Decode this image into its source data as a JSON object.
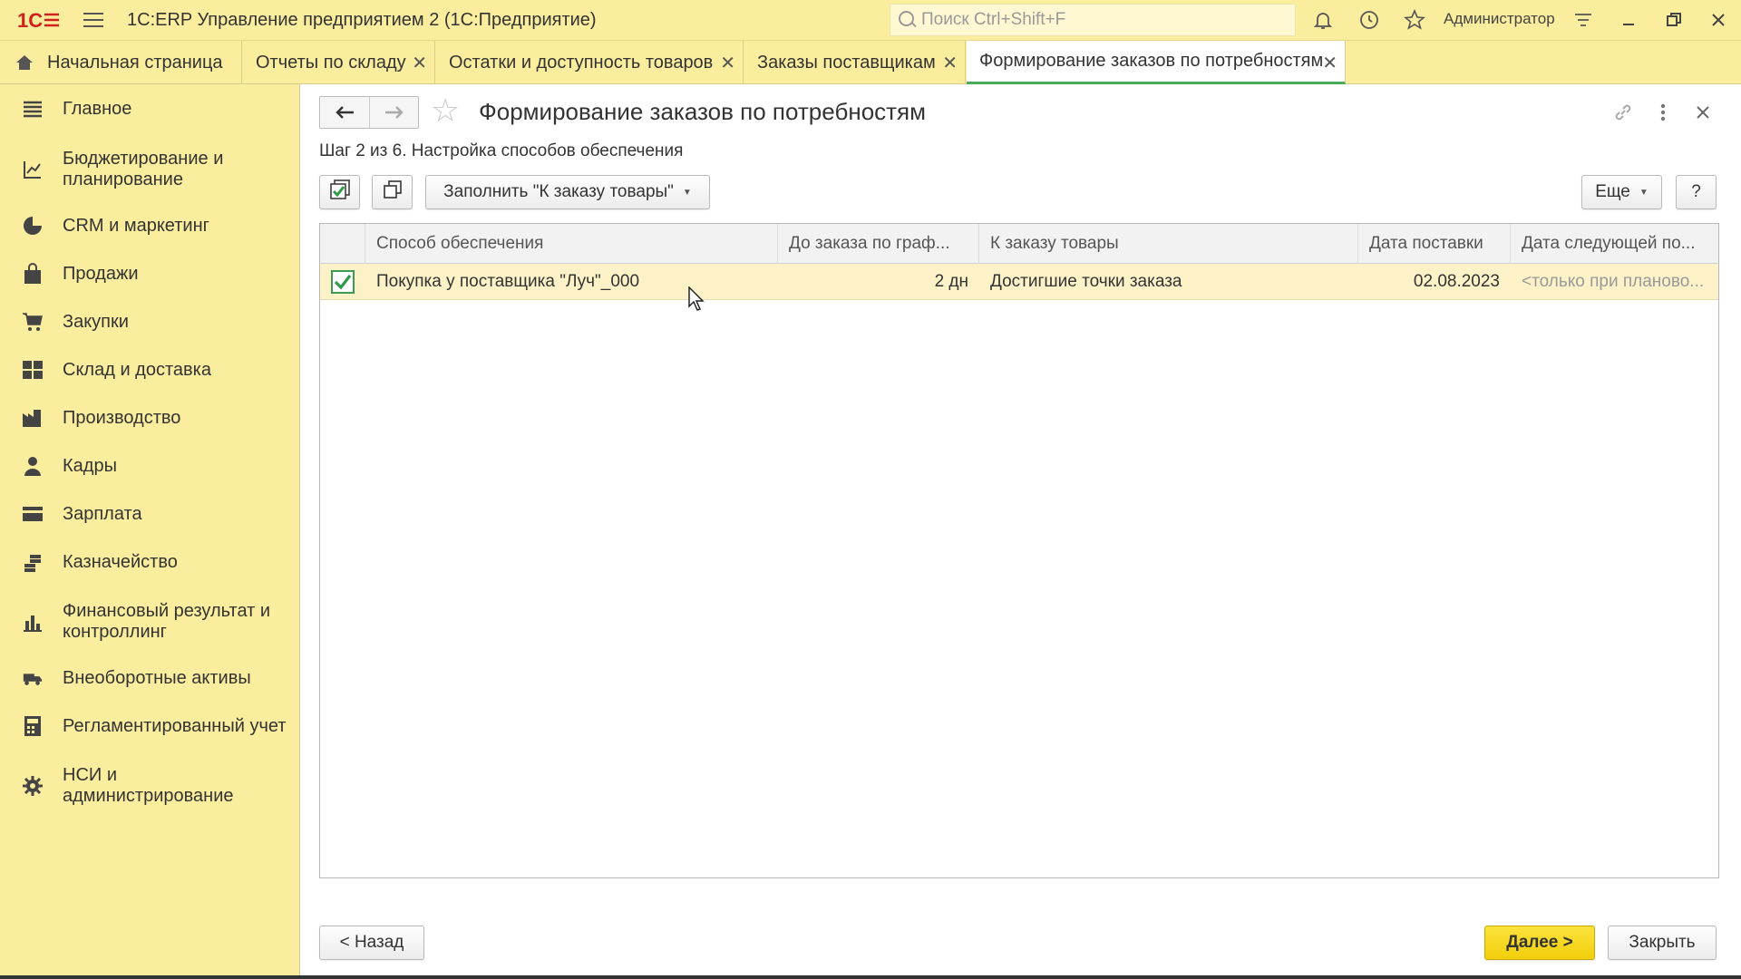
{
  "app": {
    "title": "1С:ERP Управление предприятием 2  (1С:Предприятие)",
    "search_placeholder": "Поиск Ctrl+Shift+F",
    "user": "Администратор",
    "accent": "#fbed9e",
    "icons": [
      "1c-logo-icon",
      "hamburger-icon",
      "search-icon",
      "bell-icon",
      "history-icon",
      "star-icon",
      "settings-icon",
      "minimize-icon",
      "restore-icon",
      "close-icon"
    ]
  },
  "tabs": [
    {
      "label": "Начальная страница"
    },
    {
      "label": "Отчеты по складу"
    },
    {
      "label": "Остатки и доступность товаров"
    },
    {
      "label": "Заказы поставщикам"
    },
    {
      "label": "Формирование заказов по потребностям"
    }
  ],
  "sidebar": {
    "items": [
      {
        "label": "Главное"
      },
      {
        "label": "Бюджетирование и планирование"
      },
      {
        "label": "CRM и маркетинг"
      },
      {
        "label": "Продажи"
      },
      {
        "label": "Закупки"
      },
      {
        "label": "Склад и доставка"
      },
      {
        "label": "Производство"
      },
      {
        "label": "Кадры"
      },
      {
        "label": "Зарплата"
      },
      {
        "label": "Казначейство"
      },
      {
        "label": "Финансовый результат и контроллинг"
      },
      {
        "label": "Внеоборотные активы"
      },
      {
        "label": "Регламентированный учет"
      },
      {
        "label": "НСИ и администрирование"
      }
    ]
  },
  "form": {
    "title": "Формирование заказов по потребностям",
    "step": "Шаг 2 из 6. Настройка способов обеспечения",
    "fill_button": "Заполнить \"К заказу товары\"",
    "more_button": "Еще",
    "help_button": "?",
    "back_button": "< Назад",
    "next_button": "Далее >",
    "close_button": "Закрыть"
  },
  "table": {
    "columns": [
      "Способ обеспечения",
      "До заказа по граф...",
      "К заказу товары",
      "Дата поставки",
      "Дата следующей по..."
    ],
    "rows": [
      {
        "checked": true,
        "method": "Покупка у поставщика \"Луч\"_000",
        "until_order": "2 дн",
        "to_order": "Достигшие точки заказа",
        "delivery_date": "02.08.2023",
        "next_date": "<только при планово..."
      }
    ]
  }
}
